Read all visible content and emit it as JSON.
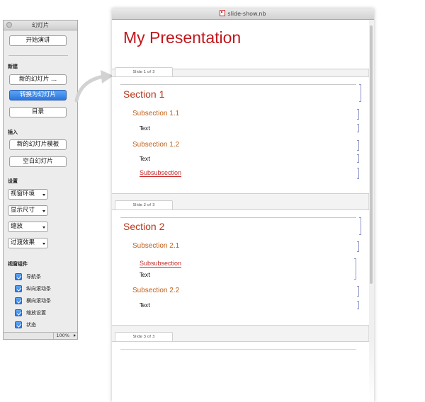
{
  "palette": {
    "title": "幻灯片",
    "start_show": "开始演讲",
    "section_new": "新建",
    "new_slide": "新的幻灯片 ...",
    "convert_to_slide": "转换为幻灯片",
    "toc": "目录",
    "section_insert": "插入",
    "new_slide_template": "新的幻灯片模板",
    "blank_slide": "空白幻灯片",
    "section_settings": "设置",
    "settings": [
      "视窗环境",
      "显示尺寸",
      "缩放",
      "过渡效果"
    ],
    "section_components": "视窗组件",
    "components": [
      "导航条",
      "纵向滚动条",
      "横向滚动条",
      "缩放设置",
      "状态"
    ],
    "zoom": "100%"
  },
  "notebook": {
    "filename": "slide-show.nb",
    "presentation_title": "My Presentation",
    "slides": [
      {
        "tab": "Slide 1 of 3",
        "section": "Section 1",
        "items": [
          {
            "kind": "subsection",
            "text": "Subsection 1.1"
          },
          {
            "kind": "text",
            "text": "Text"
          },
          {
            "kind": "subsection",
            "text": "Subsection 1.2"
          },
          {
            "kind": "text",
            "text": "Text"
          },
          {
            "kind": "subsubsection",
            "text": "Subsubsection"
          }
        ]
      },
      {
        "tab": "Slide 2 of 3",
        "section": "Section 2",
        "items": [
          {
            "kind": "subsection",
            "text": "Subsection 2.1"
          },
          {
            "kind": "subsubsection",
            "text": "Subsubsection"
          },
          {
            "kind": "text",
            "text": "Text"
          },
          {
            "kind": "subsection",
            "text": "Subsection 2.2"
          },
          {
            "kind": "text",
            "text": "Text"
          }
        ]
      },
      {
        "tab": "Slide 3 of 3"
      }
    ]
  },
  "colors": {
    "title_red": "#c1161c",
    "section": "#b4371b",
    "subsection": "#c0601a",
    "accent_blue": "#2b75e0",
    "cell_bracket": "#8a92c8"
  }
}
